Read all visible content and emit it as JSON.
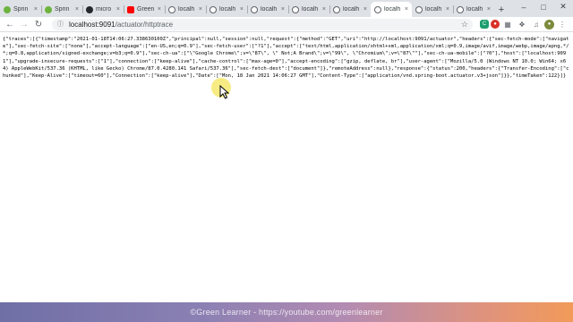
{
  "browser": {
    "tabs": [
      {
        "label": "Sprin",
        "icon": "spring-leaf-icon",
        "active": false
      },
      {
        "label": "Sprin",
        "icon": "spring-leaf-icon",
        "active": false
      },
      {
        "label": "micro",
        "icon": "github-icon",
        "active": false
      },
      {
        "label": "Green",
        "icon": "youtube-icon",
        "active": false
      },
      {
        "label": "localh",
        "icon": "globe-icon",
        "active": false
      },
      {
        "label": "localh",
        "icon": "globe-icon",
        "active": false
      },
      {
        "label": "localh",
        "icon": "globe-icon",
        "active": false
      },
      {
        "label": "localh",
        "icon": "globe-icon",
        "active": false
      },
      {
        "label": "localh",
        "icon": "globe-icon",
        "active": false
      },
      {
        "label": "localh",
        "icon": "globe-icon",
        "active": true
      },
      {
        "label": "localh",
        "icon": "globe-icon",
        "active": false
      },
      {
        "label": "localh",
        "icon": "globe-icon",
        "active": false
      }
    ],
    "address": {
      "host": "localhost:9091",
      "path": "/actuator/httptrace"
    }
  },
  "page": {
    "body": "{\"traces\":[{\"timestamp\":\"2021-01-18T14:06:27.338630100Z\",\"principal\":null,\"session\":null,\"request\":{\"method\":\"GET\",\"uri\":\"http://localhost:9091/actuator\",\"headers\":{\"sec-fetch-mode\":[\"navigate\"],\"sec-fetch-site\":[\"none\"],\"accept-language\":[\"en-US,en;q=0.9\"],\"sec-fetch-user\":[\"?1\"],\"accept\":[\"text/html,application/xhtml+xml,application/xml;q=0.9,image/avif,image/webp,image/apng,*/*;q=0.8,application/signed-exchange;v=b3;q=0.9\"],\"sec-ch-ua\":[\"\\\"Google Chrome\\\";v=\\\"87\\\", \\\" Not;A Brand\\\";v=\\\"99\\\", \\\"Chromium\\\";v=\\\"87\\\"\"],\"sec-ch-ua-mobile\":[\"?0\"],\"host\":[\"localhost:9091\"],\"upgrade-insecure-requests\":[\"1\"],\"connection\":[\"keep-alive\"],\"cache-control\":[\"max-age=0\"],\"accept-encoding\":[\"gzip, deflate, br\"],\"user-agent\":[\"Mozilla/5.0 (Windows NT 10.0; Win64; x64) AppleWebKit/537.36 (KHTML, like Gecko) Chrome/87.0.4280.141 Safari/537.36\"],\"sec-fetch-dest\":[\"document\"]},\"remoteAddress\":null},\"response\":{\"status\":200,\"headers\":{\"Transfer-Encoding\":[\"chunked\"],\"Keep-Alive\":[\"timeout=60\"],\"Connection\":[\"keep-alive\"],\"Date\":[\"Mon, 18 Jan 2021 14:06:27 GMT\"],\"Content-Type\":[\"application/vnd.spring-boot.actuator.v3+json\"]}},\"timeTaken\":122}]}"
  },
  "banner": {
    "text": "©Green Learner - https://youtube.com/greenlearner"
  }
}
